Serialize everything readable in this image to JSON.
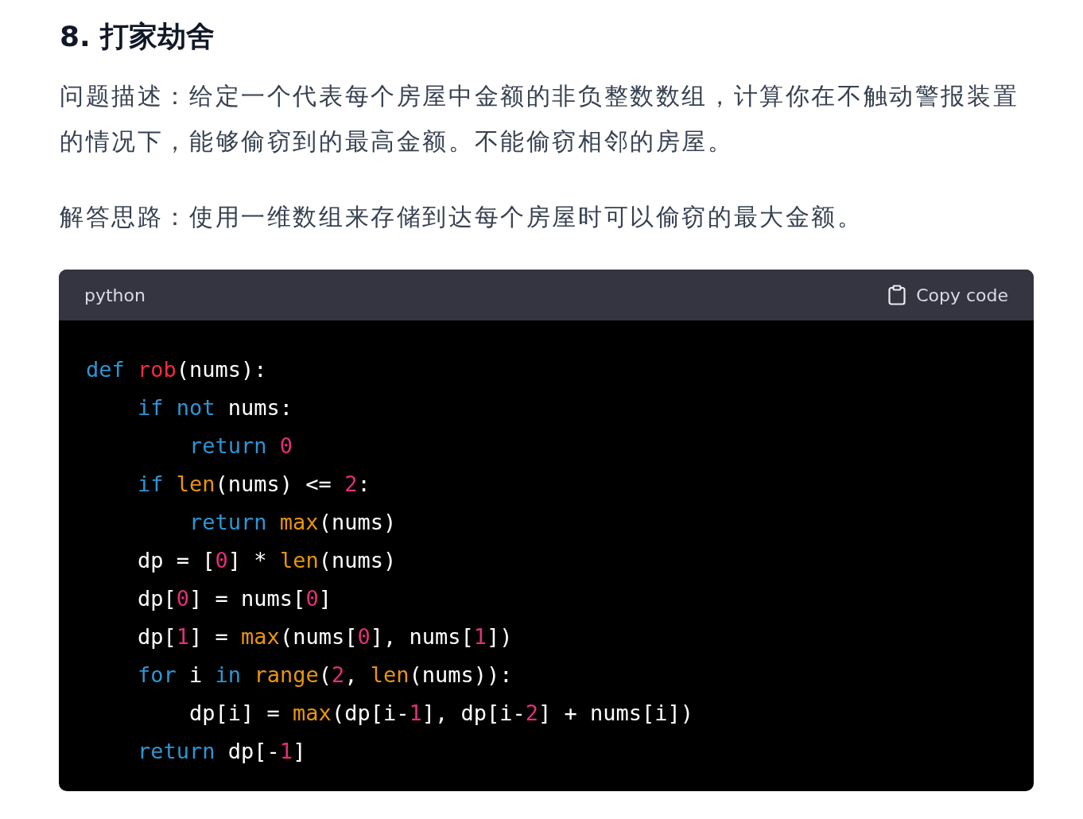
{
  "heading": "8. 打家劫舍",
  "paragraphs": [
    "问题描述：给定一个代表每个房屋中金额的非负整数数组，计算你在不触动警报装置的情况下，能够偷窃到的最高金额。不能偷窃相邻的房屋。",
    "解答思路：使用一维数组来存储到达每个房屋时可以偷窃的最大金额。"
  ],
  "code_block": {
    "language": "python",
    "copy_label": "Copy code",
    "lines": [
      {
        "tokens": [
          {
            "kind": "kw",
            "text": "def"
          },
          {
            "kind": "fn",
            "text": "rob",
            "gap": true
          },
          {
            "kind": "txt",
            "text": "(nums):"
          }
        ],
        "children": [
          {
            "tokens": [
              {
                "kind": "kw",
                "text": "if"
              },
              {
                "kind": "kw",
                "text": "not",
                "gap": true
              },
              {
                "kind": "txt",
                "text": "nums:",
                "gap": true
              }
            ],
            "children": [
              {
                "tokens": [
                  {
                    "kind": "kw",
                    "text": "return"
                  },
                  {
                    "kind": "num",
                    "text": "0",
                    "gap": true
                  }
                ]
              }
            ]
          },
          {
            "tokens": [
              {
                "kind": "kw",
                "text": "if"
              },
              {
                "kind": "bi",
                "text": "len",
                "gap": true
              },
              {
                "kind": "txt",
                "text": "(nums) <="
              },
              {
                "kind": "num",
                "text": "2",
                "gap": true
              },
              {
                "kind": "txt",
                "text": ":"
              }
            ],
            "children": [
              {
                "tokens": [
                  {
                    "kind": "kw",
                    "text": "return"
                  },
                  {
                    "kind": "bi",
                    "text": "max",
                    "gap": true
                  },
                  {
                    "kind": "txt",
                    "text": "(nums)"
                  }
                ]
              }
            ]
          },
          {
            "tokens": [
              {
                "kind": "txt",
                "text": "dp = ["
              },
              {
                "kind": "num",
                "text": "0"
              },
              {
                "kind": "txt",
                "text": "] *"
              },
              {
                "kind": "bi",
                "text": "len",
                "gap": true
              },
              {
                "kind": "txt",
                "text": "(nums)"
              }
            ]
          },
          {
            "tokens": [
              {
                "kind": "txt",
                "text": "dp["
              },
              {
                "kind": "num",
                "text": "0"
              },
              {
                "kind": "txt",
                "text": "] = nums["
              },
              {
                "kind": "num",
                "text": "0"
              },
              {
                "kind": "txt",
                "text": "]"
              }
            ]
          },
          {
            "tokens": [
              {
                "kind": "txt",
                "text": "dp["
              },
              {
                "kind": "num",
                "text": "1"
              },
              {
                "kind": "txt",
                "text": "] ="
              },
              {
                "kind": "bi",
                "text": "max",
                "gap": true
              },
              {
                "kind": "txt",
                "text": "(nums["
              },
              {
                "kind": "num",
                "text": "0"
              },
              {
                "kind": "txt",
                "text": "], nums["
              },
              {
                "kind": "num",
                "text": "1"
              },
              {
                "kind": "txt",
                "text": "])"
              }
            ]
          },
          {
            "tokens": [
              {
                "kind": "kw",
                "text": "for"
              },
              {
                "kind": "txt",
                "text": "i",
                "gap": true
              },
              {
                "kind": "kw",
                "text": "in",
                "gap": true
              },
              {
                "kind": "bi",
                "text": "range",
                "gap": true
              },
              {
                "kind": "txt",
                "text": "("
              },
              {
                "kind": "num",
                "text": "2"
              },
              {
                "kind": "txt",
                "text": ","
              },
              {
                "kind": "bi",
                "text": "len",
                "gap": true
              },
              {
                "kind": "txt",
                "text": "(nums)):"
              }
            ],
            "children": [
              {
                "tokens": [
                  {
                    "kind": "txt",
                    "text": "dp[i] ="
                  },
                  {
                    "kind": "bi",
                    "text": "max",
                    "gap": true
                  },
                  {
                    "kind": "txt",
                    "text": "(dp[i-"
                  },
                  {
                    "kind": "num",
                    "text": "1"
                  },
                  {
                    "kind": "txt",
                    "text": "], dp[i-"
                  },
                  {
                    "kind": "num",
                    "text": "2"
                  },
                  {
                    "kind": "txt",
                    "text": "] + nums[i])"
                  }
                ]
              }
            ]
          },
          {
            "tokens": [
              {
                "kind": "kw",
                "text": "return"
              },
              {
                "kind": "txt",
                "text": "dp[-",
                "gap": true
              },
              {
                "kind": "num",
                "text": "1"
              },
              {
                "kind": "txt",
                "text": "]"
              }
            ]
          }
        ]
      }
    ]
  }
}
